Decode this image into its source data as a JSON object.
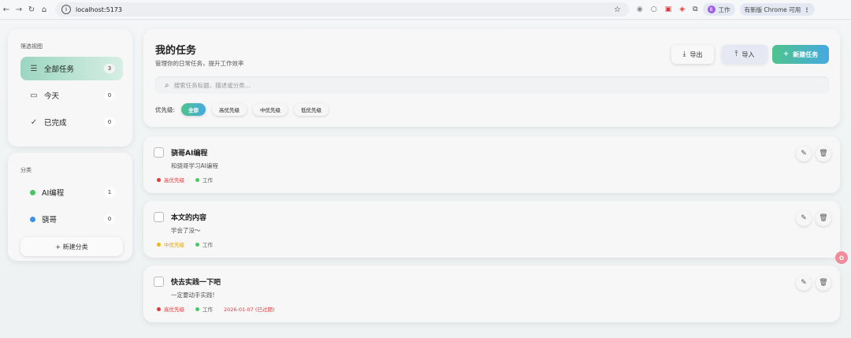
{
  "browser": {
    "url": "localhost:5173",
    "profile_label": "工作",
    "profile_initial": "B",
    "update_label": "有新版 Chrome 可用"
  },
  "sidebar": {
    "views_title": "筛选视图",
    "views": [
      {
        "label": "全部任务",
        "count": "3",
        "icon": "list-icon"
      },
      {
        "label": "今天",
        "count": "0",
        "icon": "calendar-icon"
      },
      {
        "label": "已完成",
        "count": "0",
        "icon": "check-icon"
      }
    ],
    "categories_title": "分类",
    "categories": [
      {
        "label": "AI编程",
        "count": "1",
        "color": "#4fc36a"
      },
      {
        "label": "骁哥",
        "count": "0",
        "color": "#3d8fe8"
      }
    ],
    "new_category_label": "+ 新建分类"
  },
  "header": {
    "title": "我的任务",
    "subtitle": "管理你的日常任务，提升工作效率",
    "export_label": "导出",
    "import_label": "导入",
    "new_task_label": "新建任务",
    "search_placeholder": "搜索任务标题、描述或分类...",
    "priority_label": "优先级:",
    "priority_filters": [
      "全部",
      "高优先级",
      "中优先级",
      "低优先级"
    ]
  },
  "colors": {
    "high": "#e53935",
    "medium": "#f5b400",
    "accent_start": "#4fc38c",
    "accent_end": "#46a9e0"
  },
  "tasks": [
    {
      "title": "骁哥AI编程",
      "description": "和骁哥学习AI编程",
      "priority": "高优先级",
      "category": "工作",
      "due": ""
    },
    {
      "title": "本文的内容",
      "description": "学会了没～",
      "priority": "中优先级",
      "category": "工作",
      "due": ""
    },
    {
      "title": "快去实践一下吧",
      "description": "一定要动手实践!",
      "priority": "高优先级",
      "category": "工作",
      "due": "2026-01-07 (已过期)"
    }
  ]
}
